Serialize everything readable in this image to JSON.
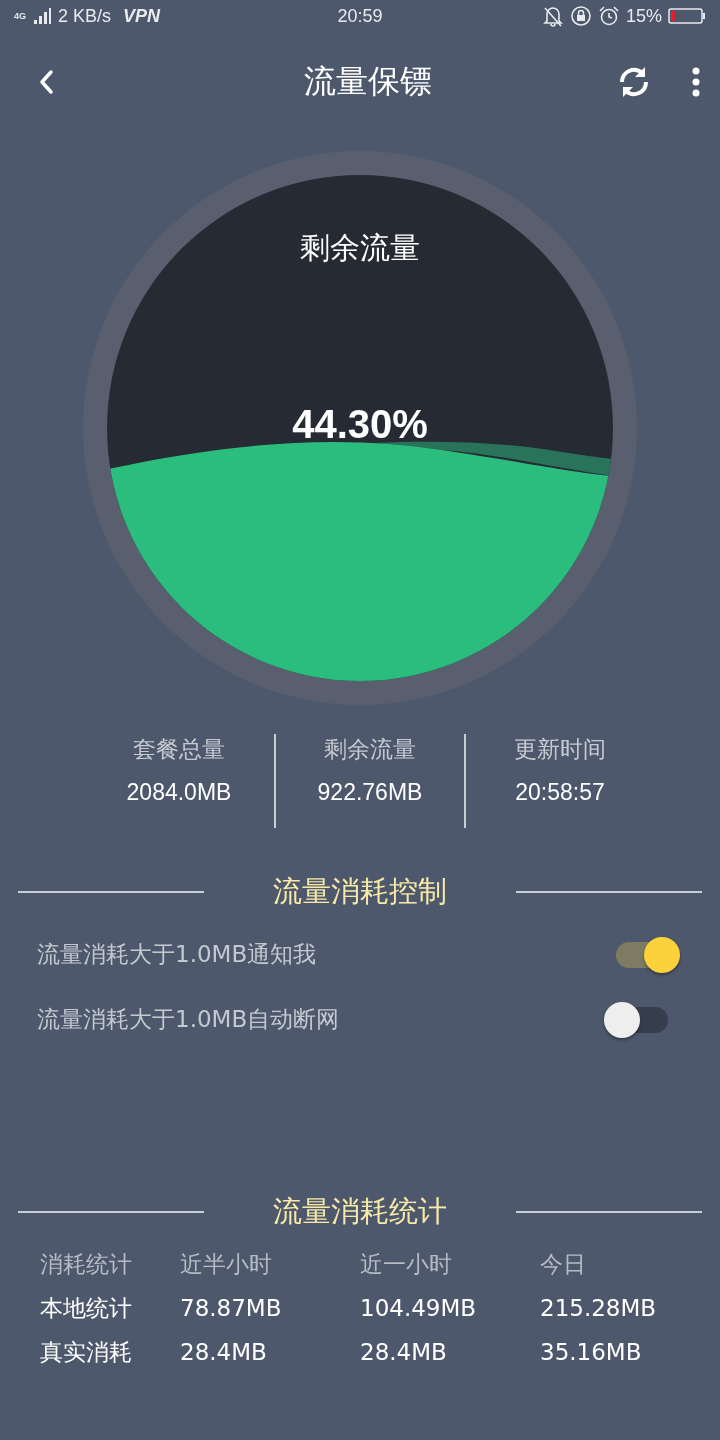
{
  "status_bar": {
    "network": "4G",
    "speed": "2 KB/s",
    "vpn": "VPN",
    "time": "20:59",
    "battery": "15%"
  },
  "header": {
    "title": "流量保镖"
  },
  "gauge": {
    "label": "剩余流量",
    "percent": "44.30%"
  },
  "summary": [
    {
      "label": "套餐总量",
      "value": "2084.0MB"
    },
    {
      "label": "剩余流量",
      "value": "922.76MB"
    },
    {
      "label": "更新时间",
      "value": "20:58:57"
    }
  ],
  "control": {
    "title": "流量消耗控制",
    "settings": [
      {
        "label": "流量消耗大于1.0MB通知我",
        "on": true
      },
      {
        "label": "流量消耗大于1.0MB自动断网",
        "on": false
      }
    ]
  },
  "stats": {
    "title": "流量消耗统计",
    "columns": [
      "消耗统计",
      "近半小时",
      "近一小时",
      "今日"
    ],
    "rows": [
      [
        "本地统计",
        "78.87MB",
        "104.49MB",
        "215.28MB"
      ],
      [
        "真实消耗",
        "28.4MB",
        "28.4MB",
        "35.16MB"
      ]
    ]
  }
}
